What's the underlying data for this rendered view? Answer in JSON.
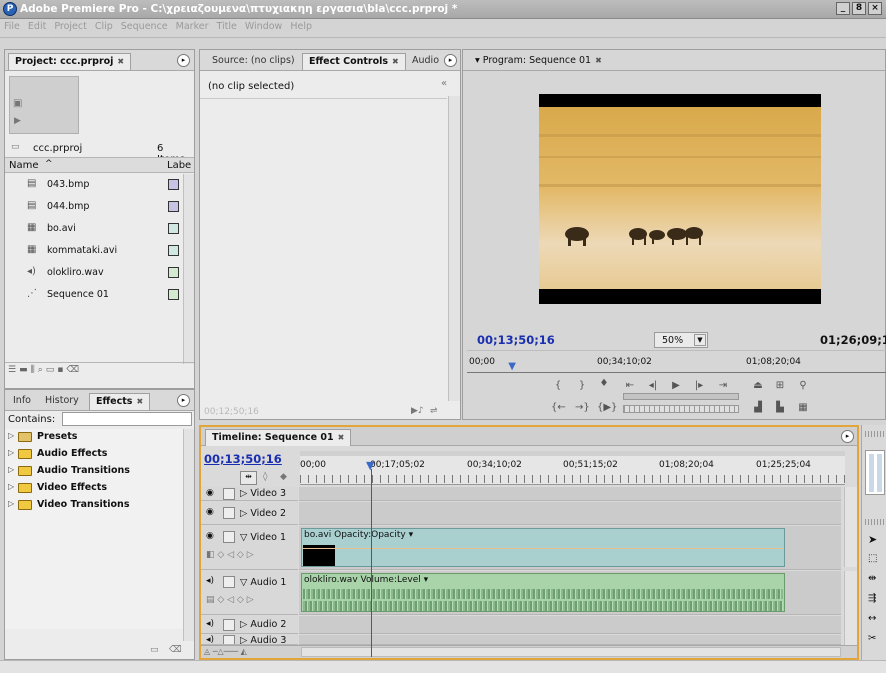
{
  "app": {
    "title": "Adobe Premiere Pro - C:\\χρειαζουμενα\\πτυχιακηη εργασια\\bla\\ccc.prproj *",
    "window_buttons": [
      "_",
      "8",
      "×"
    ]
  },
  "menu": [
    "File",
    "Edit",
    "Project",
    "Clip",
    "Sequence",
    "Marker",
    "Title",
    "Window",
    "Help"
  ],
  "project": {
    "tab_label": "Project: ccc.prproj",
    "file_name": "ccc.prproj",
    "item_count": "6 Items",
    "col_name": "Name",
    "col_label": "Labe",
    "items": [
      {
        "name": "043.bmp",
        "icon": "image-icon",
        "color": "#c7c3e4"
      },
      {
        "name": "044.bmp",
        "icon": "image-icon",
        "color": "#c7c3e4"
      },
      {
        "name": "bo.avi",
        "icon": "video-clip-icon",
        "color": "#cfe9e2"
      },
      {
        "name": "kommataki.avi",
        "icon": "video-clip-icon",
        "color": "#cfe9e2"
      },
      {
        "name": "oloklіro.wav",
        "icon": "audio-icon",
        "color": "#d4ead0"
      },
      {
        "name": "Sequence 01",
        "icon": "sequence-icon",
        "color": "#d4ead0"
      }
    ]
  },
  "source": {
    "tabs": [
      "Source: (no clips)",
      "Effect Controls",
      "Audio"
    ],
    "no_clip": "(no clip selected)",
    "timecode": "00;12;50;16"
  },
  "program": {
    "tab_label": "Program: Sequence 01",
    "timecode_current": "00;13;50;16",
    "zoom": "50%",
    "timecode_duration": "01;26;09;19",
    "ruler_labels": [
      "00;00",
      "00;34;10;02",
      "01;08;20;04"
    ],
    "playhead_fraction": 0.11
  },
  "bottom_left": {
    "tabs": [
      "Info",
      "History",
      "Effects"
    ],
    "contains_label": "Contains:",
    "folders": [
      "Presets",
      "Audio Effects",
      "Audio Transitions",
      "Video Effects",
      "Video Transitions"
    ]
  },
  "timeline": {
    "tab_label": "Timeline: Sequence 01",
    "timecode": "00;13;50;16",
    "ruler_labels": [
      "00;00",
      "00;17;05;02",
      "00;34;10;02",
      "00;51;15;02",
      "01;08;20;04",
      "01;25;25;04"
    ],
    "playhead_fraction": 0.132,
    "tracks": [
      {
        "name": "Video 3"
      },
      {
        "name": "Video 2"
      },
      {
        "name": "Video 1"
      },
      {
        "name": "Audio 1"
      },
      {
        "name": "Audio 2"
      },
      {
        "name": "Audio 3"
      }
    ],
    "video_clip_label": "bo.avi Opacity:Opacity ▾",
    "audio_clip_label": "oloklіro.wav Volume:Level ▾"
  },
  "colors": {
    "timecode_blue": "#1a2fb0",
    "timeline_border": "#e2a53a",
    "video_clip": "#a9cfcf",
    "audio_clip": "#a9d4aa",
    "playhead": "#e02020"
  }
}
